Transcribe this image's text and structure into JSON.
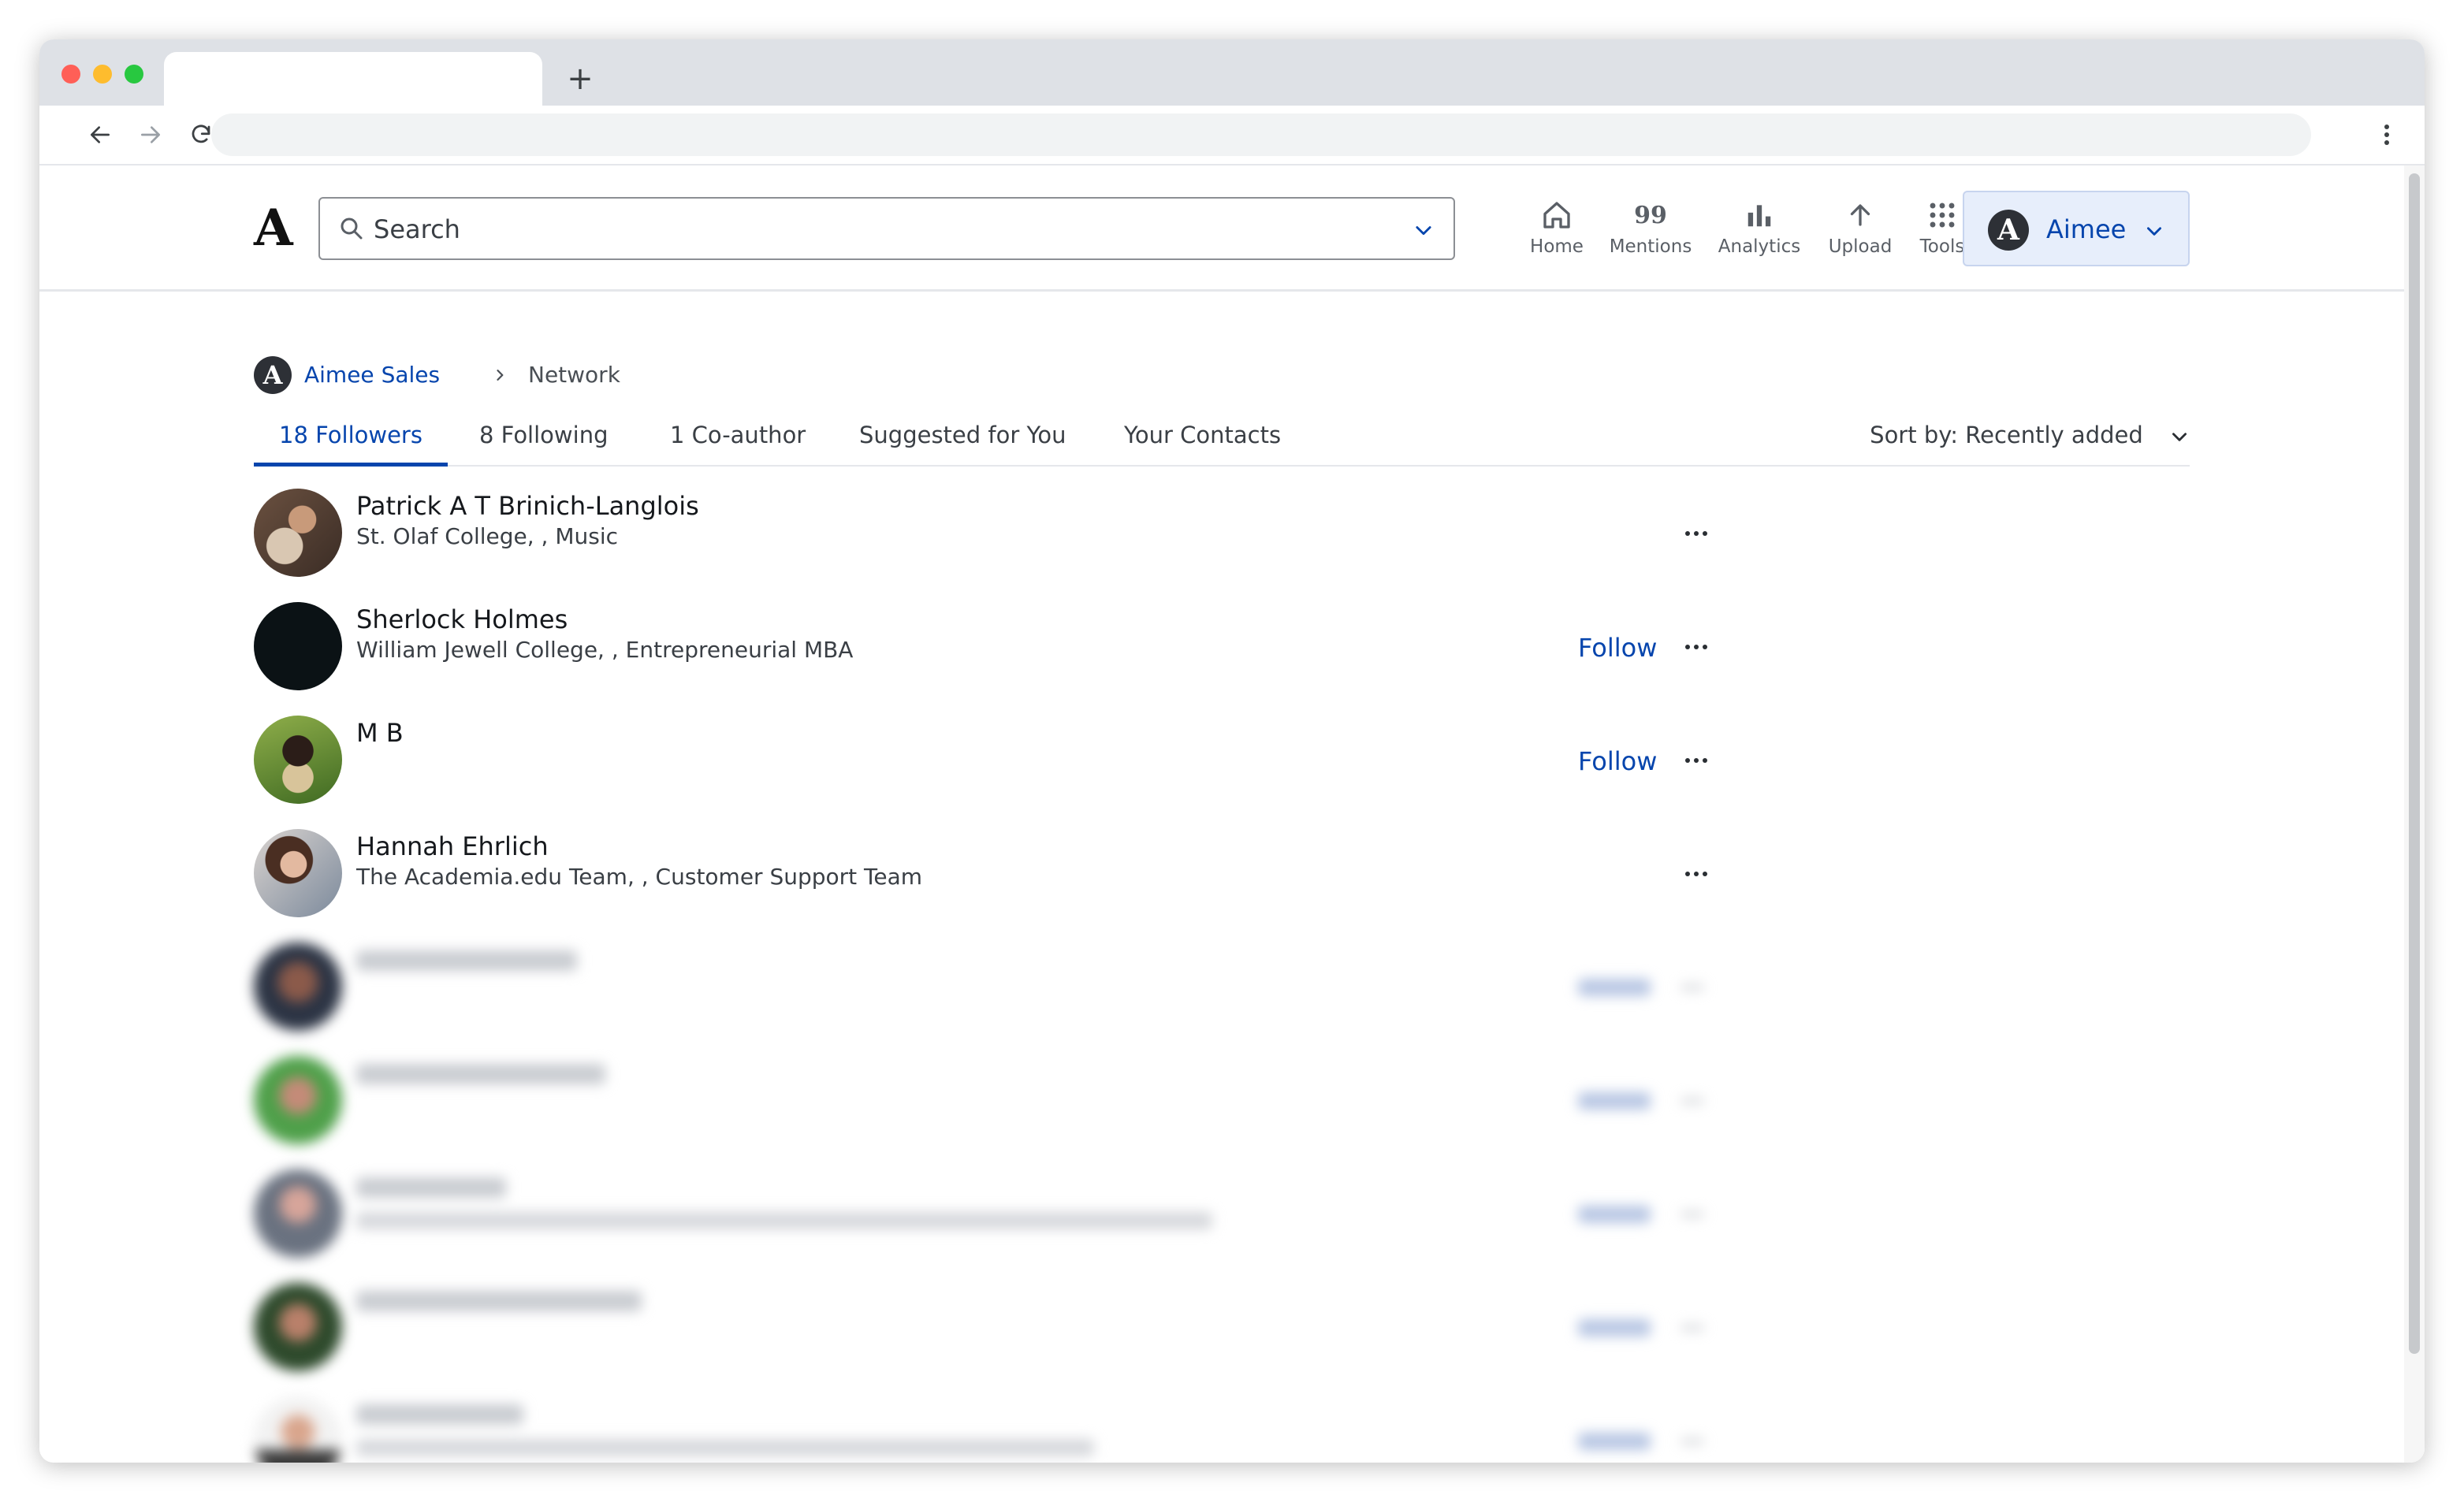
{
  "header": {
    "logo": "A",
    "search_placeholder": "Search",
    "nav": [
      {
        "label": "Home",
        "icon": "home-icon"
      },
      {
        "label": "Mentions",
        "icon": "quote-icon",
        "glyph": "99"
      },
      {
        "label": "Analytics",
        "icon": "bar-chart-icon"
      },
      {
        "label": "Upload",
        "icon": "arrow-up-icon"
      },
      {
        "label": "Tools",
        "icon": "grid-icon"
      }
    ],
    "account": {
      "initial": "A",
      "name": "Aimee"
    }
  },
  "breadcrumb": {
    "initial": "A",
    "profile": "Aimee Sales",
    "current": "Network"
  },
  "tabs": [
    {
      "label": "18 Followers",
      "active": true
    },
    {
      "label": "8 Following",
      "active": false
    },
    {
      "label": "1 Co-author",
      "active": false
    },
    {
      "label": "Suggested for You",
      "active": false
    },
    {
      "label": "Your Contacts",
      "active": false
    }
  ],
  "sort": {
    "label": "Sort by: Recently added"
  },
  "follow_label": "Follow",
  "followers": [
    {
      "name": "Patrick A T Brinich-Langlois",
      "subtitle": "St. Olaf College, , Music",
      "follow": false
    },
    {
      "name": "Sherlock Holmes",
      "subtitle": "William Jewell College, , Entrepreneurial MBA",
      "follow": true
    },
    {
      "name": "M B",
      "subtitle": "",
      "follow": true
    },
    {
      "name": "Hannah Ehrlich",
      "subtitle": "The Academia.edu Team, , Customer Support Team",
      "follow": false
    }
  ],
  "colors": {
    "accent": "#0645ad",
    "account_bg": "#e7eefb",
    "text": "#15181c"
  }
}
